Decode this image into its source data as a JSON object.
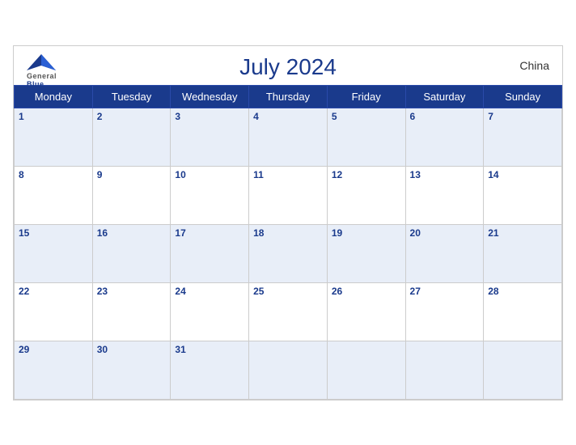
{
  "header": {
    "title": "July 2024",
    "country": "China",
    "logo_general": "General",
    "logo_blue": "Blue"
  },
  "weekdays": [
    "Monday",
    "Tuesday",
    "Wednesday",
    "Thursday",
    "Friday",
    "Saturday",
    "Sunday"
  ],
  "weeks": [
    [
      1,
      2,
      3,
      4,
      5,
      6,
      7
    ],
    [
      8,
      9,
      10,
      11,
      12,
      13,
      14
    ],
    [
      15,
      16,
      17,
      18,
      19,
      20,
      21
    ],
    [
      22,
      23,
      24,
      25,
      26,
      27,
      28
    ],
    [
      29,
      30,
      31,
      null,
      null,
      null,
      null
    ]
  ]
}
